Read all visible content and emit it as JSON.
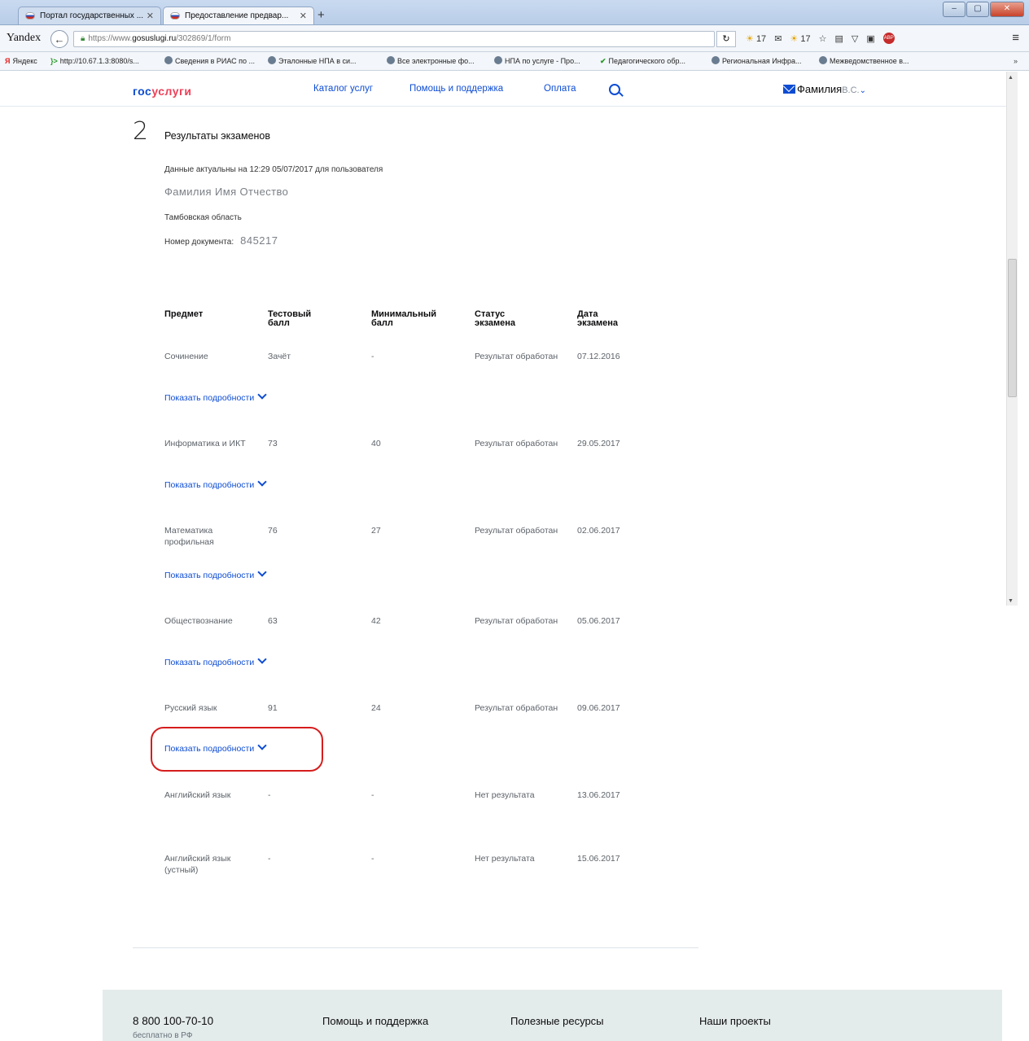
{
  "browser": {
    "tabs": [
      {
        "label": "Портал государственных ...",
        "active": false
      },
      {
        "label": "Предоставление предвар...",
        "active": true
      }
    ],
    "new_tab": "+",
    "window_buttons": {
      "minimize": "–",
      "maximize": "▢",
      "close": "✕"
    },
    "brand": "Yandex",
    "url_prefix": "https://www.",
    "url_domain": "gosuslugi.ru",
    "url_path": "/302869/1/form",
    "reload": "↻",
    "weather_1": "17",
    "weather_2": "17",
    "menu": "≡",
    "bookmarks": [
      {
        "label": "Яндекс",
        "icon": "yandex-icon"
      },
      {
        "label": "http://10.67.1.3:8080/s...",
        "icon": "arrow-icon"
      },
      {
        "label": "Сведения в РИАС по ...",
        "icon": "globe-icon"
      },
      {
        "label": "Эталонные НПА в си...",
        "icon": "globe-icon"
      },
      {
        "label": "Все электронные фо...",
        "icon": "globe-icon"
      },
      {
        "label": "НПА по услуге - Про...",
        "icon": "globe-icon"
      },
      {
        "label": "Педагогического обр...",
        "icon": "check-icon"
      },
      {
        "label": "Региональная Инфра...",
        "icon": "globe-icon"
      },
      {
        "label": "Межведомственное в...",
        "icon": "globe-icon"
      }
    ],
    "bookmarks_more": "»"
  },
  "header": {
    "logo_part1": "гос",
    "logo_part2": "услуги",
    "nav": [
      "Каталог услуг",
      "Помощь и поддержка",
      "Оплата"
    ],
    "user_name": "Фамилия",
    "user_initials": "В.С.",
    "user_chevron": "⌄"
  },
  "step": {
    "number": "2",
    "title": "Результаты экзаменов"
  },
  "info": {
    "actual": "Данные актуальны на 12:29 05/07/2017 для пользователя",
    "full_name": "Фамилия Имя Отчество",
    "region": "Тамбовская область",
    "doc_label": "Номер документа:",
    "doc_number": "845217"
  },
  "table": {
    "headers": [
      {
        "l1": "Предмет",
        "l2": ""
      },
      {
        "l1": "Тестовый",
        "l2": "балл"
      },
      {
        "l1": "Минимальный",
        "l2": "балл"
      },
      {
        "l1": "Статус",
        "l2": "экзамена"
      },
      {
        "l1": "Дата",
        "l2": "экзамена"
      }
    ],
    "rows": [
      {
        "subject_1": "Сочинение",
        "subject_2": "",
        "score": "Зачёт",
        "min": "-",
        "status": "Результат обработан",
        "date": "07.12.2016"
      },
      {
        "subject_1": "Информатика и ИКТ",
        "subject_2": "",
        "score": "73",
        "min": "40",
        "status": "Результат обработан",
        "date": "29.05.2017"
      },
      {
        "subject_1": "Математика",
        "subject_2": "профильная",
        "score": "76",
        "min": "27",
        "status": "Результат обработан",
        "date": "02.06.2017"
      },
      {
        "subject_1": "Обществознание",
        "subject_2": "",
        "score": "63",
        "min": "42",
        "status": "Результат обработан",
        "date": "05.06.2017"
      },
      {
        "subject_1": "Русский язык",
        "subject_2": "",
        "score": "91",
        "min": "24",
        "status": "Результат обработан",
        "date": "09.06.2017"
      },
      {
        "subject_1": "Английский язык",
        "subject_2": "",
        "score": "-",
        "min": "-",
        "status": "Нет результата",
        "date": "13.06.2017"
      },
      {
        "subject_1": "Английский язык",
        "subject_2": "(устный)",
        "score": "-",
        "min": "-",
        "status": "Нет результата",
        "date": "15.06.2017"
      }
    ],
    "details_label": "Показать подробности"
  },
  "footer": {
    "phone": "8 800 100-70-10",
    "phone_note": "бесплатно в РФ",
    "links": [
      "Помощь и поддержка",
      "Полезные ресурсы",
      "Наши проекты"
    ]
  },
  "colors": {
    "link": "#0d4cd3",
    "accent_red": "#ee3f58",
    "annotation": "#d61d1d",
    "footer_bg": "#e4ebeb"
  }
}
